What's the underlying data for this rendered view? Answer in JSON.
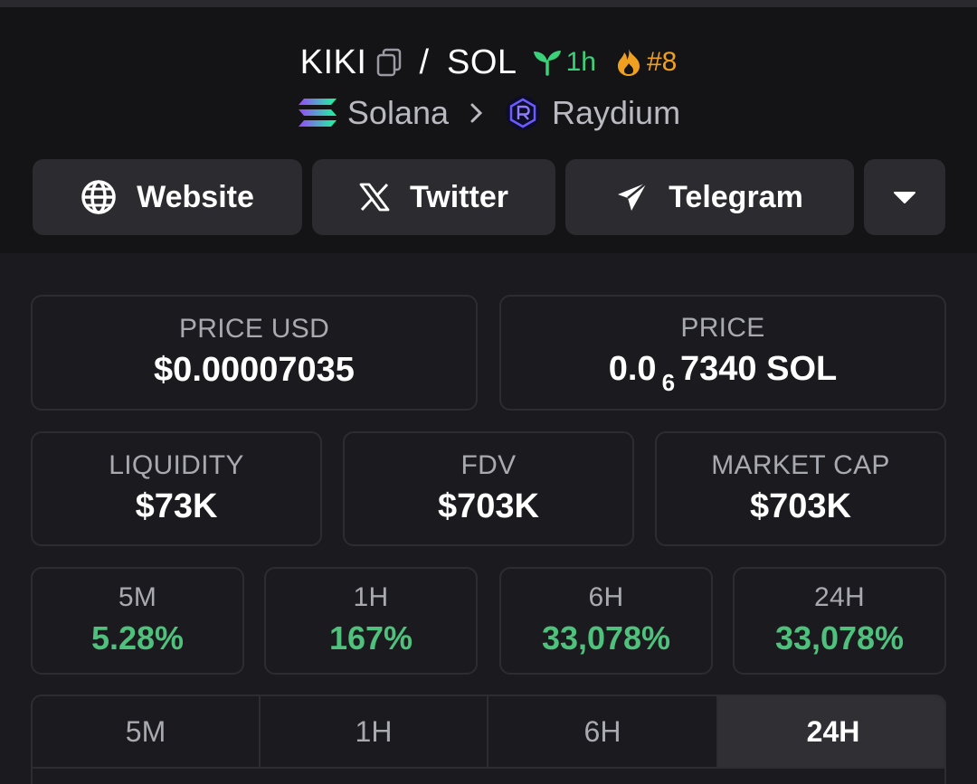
{
  "header": {
    "base_symbol": "KIKI",
    "slash": "/",
    "quote_symbol": "SOL",
    "age": "1h",
    "rank": "#8",
    "chain": "Solana",
    "dex": "Raydium"
  },
  "links": {
    "website": "Website",
    "twitter": "Twitter",
    "telegram": "Telegram"
  },
  "stats": {
    "price_usd_label": "PRICE USD",
    "price_usd": "$0.00007035",
    "price_label": "PRICE",
    "price_prefix": "0.0",
    "price_zeros": "6",
    "price_digits": "7340 SOL",
    "liquidity_label": "LIQUIDITY",
    "liquidity": "$73K",
    "fdv_label": "FDV",
    "fdv": "$703K",
    "mcap_label": "MARKET CAP",
    "mcap": "$703K"
  },
  "changes": [
    {
      "label": "5M",
      "value": "5.28%"
    },
    {
      "label": "1H",
      "value": "167%"
    },
    {
      "label": "6H",
      "value": "33,078%"
    },
    {
      "label": "24H",
      "value": "33,078%"
    }
  ],
  "tabs": [
    {
      "label": "5M"
    },
    {
      "label": "1H"
    },
    {
      "label": "6H"
    },
    {
      "label": "24H",
      "active": true
    }
  ],
  "colors": {
    "positive": "#4fc17c",
    "age_green": "#3bd07a",
    "rank_orange": "#f0a020"
  }
}
